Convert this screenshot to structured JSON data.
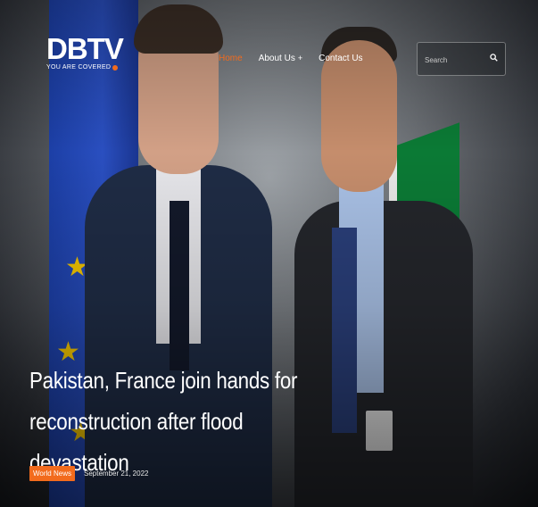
{
  "brand": {
    "logo_text": "DBTV",
    "tagline": "YOU ARE COVERED",
    "accent_color": "#f26b1d"
  },
  "nav": {
    "items": [
      {
        "label": "Home",
        "active": true
      },
      {
        "label": "About Us",
        "has_submenu": true,
        "submenu_icon": "+"
      },
      {
        "label": "Contact Us"
      }
    ]
  },
  "search": {
    "placeholder": "Search",
    "icon": "search-icon"
  },
  "article": {
    "title": "Pakistan, France join hands for reconstruction after flood devastation",
    "category": "World News",
    "date": "September 21, 2022"
  }
}
